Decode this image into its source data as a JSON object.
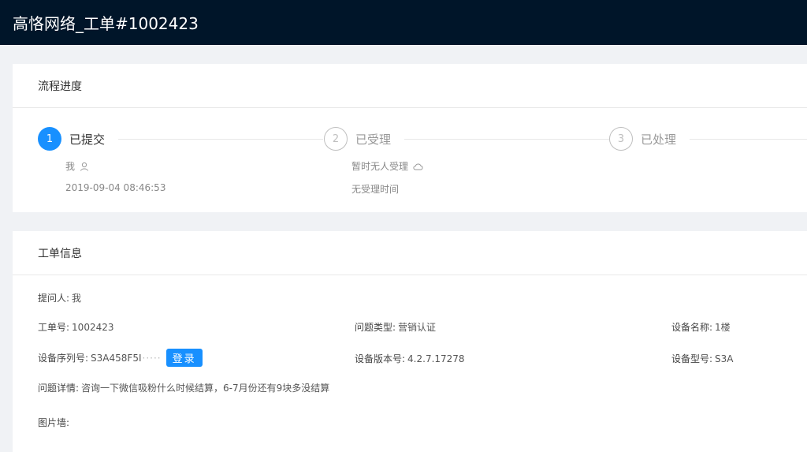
{
  "header": {
    "title": "高恪网络_工单#1002423"
  },
  "progress": {
    "title": "流程进度",
    "steps": [
      {
        "num": "1",
        "label": "已提交",
        "who": "我",
        "time": "2019-09-04 08:46:53"
      },
      {
        "num": "2",
        "label": "已受理",
        "who": "暂时无人受理",
        "time": "无受理时间"
      },
      {
        "num": "3",
        "label": "已处理"
      }
    ]
  },
  "info": {
    "title": "工单信息",
    "submitter": {
      "label": "提问人:",
      "value": "我"
    },
    "ticket_no": {
      "label": "工单号:",
      "value": "1002423"
    },
    "problem_type": {
      "label": "问题类型:",
      "value": "营销认证"
    },
    "device_name": {
      "label": "设备名称:",
      "value": "1楼"
    },
    "serial": {
      "label": "设备序列号:",
      "value": "S3A458F5I",
      "masked": "·····"
    },
    "login_button": "登录",
    "firmware": {
      "label": "设备版本号:",
      "value": "4.2.7.17278"
    },
    "model": {
      "label": "设备型号:",
      "value": "S3A"
    },
    "detail": {
      "label": "问题详情:",
      "value": "咨询一下微信吸粉什么时候结算，6-7月份还有9块多没结算"
    },
    "gallery": {
      "label": "图片墙:"
    }
  },
  "colors": {
    "header_bg": "#001529",
    "accent": "#1890ff",
    "page_bg": "#f0f2f5"
  }
}
